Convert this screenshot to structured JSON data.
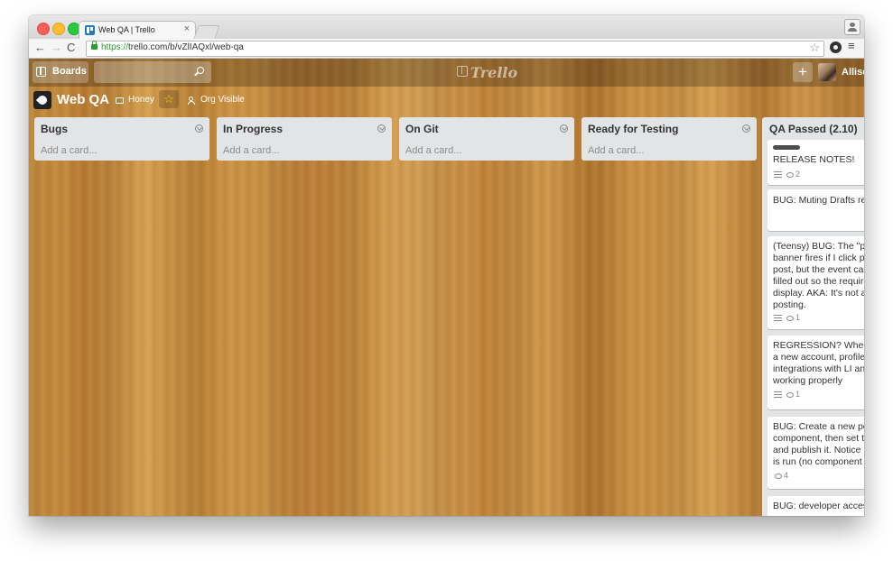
{
  "browser": {
    "tab_title": "Web QA | Trello",
    "tab_close": "×",
    "url_scheme": "https://",
    "url_rest": "trello.com/b/vZlIAQxl/web-qa",
    "back": "←",
    "forward": "→",
    "reload": "C",
    "bookmark_star": "☆",
    "menu": "≡"
  },
  "header": {
    "boards_label": "Boards",
    "search_value": "",
    "logo_text": "Trello",
    "add_label": "+",
    "user_name": "Allison"
  },
  "board": {
    "name": "Web QA",
    "team": "Honey",
    "star": "☆",
    "visibility": "Org Visible"
  },
  "lists": [
    {
      "title": "Bugs",
      "add_card": "Add a card..."
    },
    {
      "title": "In Progress",
      "add_card": "Add a card..."
    },
    {
      "title": "On Git",
      "add_card": "Add a card..."
    },
    {
      "title": "Ready for Testing",
      "add_card": "Add a card..."
    }
  ],
  "qa_list": {
    "title": "QA Passed (2.10)",
    "cards": [
      {
        "lines": [
          "RELEASE NOTES!"
        ],
        "comments": "2"
      },
      {
        "lines": [
          "BUG: Muting Drafts re"
        ]
      },
      {
        "lines": [
          "(Teensy) BUG: The \"po",
          "banner fires if I click pu",
          "post, but the event can",
          "filled out so the require",
          "display. AKA: It's not a",
          "posting."
        ],
        "comments": "1"
      },
      {
        "lines": [
          "REGRESSION? When I",
          "a new account, profile",
          "integrations with LI and",
          "working properly"
        ],
        "comments": "1"
      },
      {
        "lines": [
          "BUG: Create a new po",
          "component, then set th",
          "and publish it. Notice n",
          "is run (no component c"
        ],
        "comments": "4"
      },
      {
        "lines": [
          "BUG: developer acces"
        ]
      }
    ]
  },
  "colors": {
    "wood": "#c58c3e",
    "list_bg": "#e2e4e6",
    "star": "#f2d600",
    "secure": "#2a9d32"
  }
}
